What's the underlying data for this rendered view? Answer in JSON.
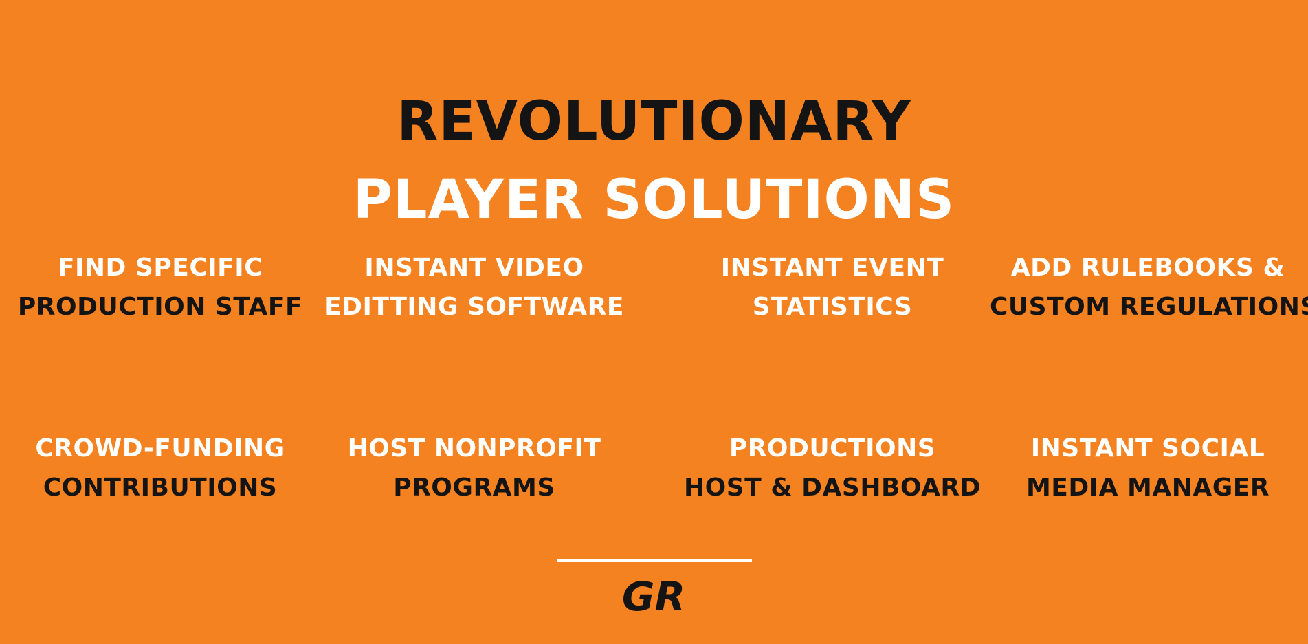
{
  "heading": {
    "line1": "REVOLUTIONARY",
    "line2": "PLAYER SOLUTIONS"
  },
  "features": [
    {
      "line1": "FIND SPECIFIC",
      "line2": "PRODUCTION STAFF"
    },
    {
      "line1": "INSTANT VIDEO",
      "line2": "EDITTING SOFTWARE"
    },
    {
      "line1": "INSTANT EVENT",
      "line2": "STATISTICS"
    },
    {
      "line1": "ADD RULEBOOKS &",
      "line2": "CUSTOM REGULATIONS"
    },
    {
      "line1": "CROWD-FUNDING",
      "line2": "CONTRIBUTIONS"
    },
    {
      "line1": "HOST NONPROFIT",
      "line2": "PROGRAMS"
    },
    {
      "line1": "PRODUCTIONS",
      "line2": "HOST & DASHBOARD"
    },
    {
      "line1": "INSTANT SOCIAL",
      "line2": "MEDIA MANAGER"
    }
  ],
  "logo": {
    "text": "GR",
    "icon": "gr-logo-icon"
  },
  "colors": {
    "background": "#F58220",
    "dark_text": "#141414",
    "light_text": "#FFFFFF"
  }
}
